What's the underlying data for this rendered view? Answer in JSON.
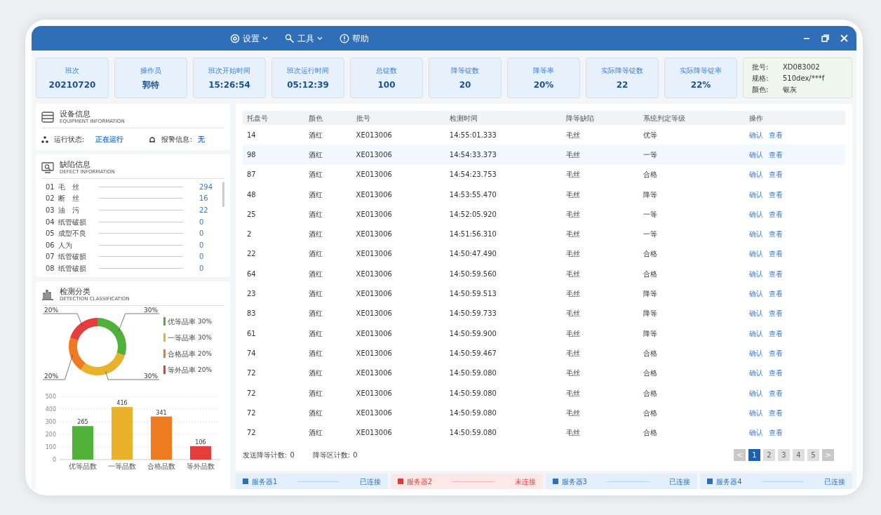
{
  "menu": [
    {
      "label": "设置",
      "dropdown": true
    },
    {
      "label": "工具",
      "dropdown": true
    },
    {
      "label": "帮助",
      "dropdown": false
    }
  ],
  "stats": [
    {
      "label": "班次",
      "value": "20210720"
    },
    {
      "label": "操作员",
      "value": "郭特"
    },
    {
      "label": "班次开始时间",
      "value": "15:26:54"
    },
    {
      "label": "班次运行时间",
      "value": "05:12:39"
    },
    {
      "label": "总锭数",
      "value": "100"
    },
    {
      "label": "降等锭数",
      "value": "20"
    },
    {
      "label": "降等率",
      "value": "20%"
    },
    {
      "label": "实际降等锭数",
      "value": "22"
    },
    {
      "label": "实际降等锭率",
      "value": "22%"
    }
  ],
  "batch_info": [
    {
      "label": "批号:",
      "value": "XD083002"
    },
    {
      "label": "规格:",
      "value": "510dex/***f"
    },
    {
      "label": "颜色:",
      "value": "银灰"
    }
  ],
  "equipment": {
    "title": "设备信息",
    "subtitle": "EQUIPMENT INFORMATION",
    "status_label": "运行状态:",
    "status_value": "正在运行",
    "alarm_label": "报警信息:",
    "alarm_value": "无"
  },
  "defects": {
    "title": "缺陷信息",
    "subtitle": "DEFECT INFORMATION",
    "items": [
      {
        "index": "01",
        "name": "毛　丝",
        "count": "294"
      },
      {
        "index": "02",
        "name": "断　丝",
        "count": "16"
      },
      {
        "index": "03",
        "name": "油　污",
        "count": "22"
      },
      {
        "index": "04",
        "name": "纸管破损",
        "count": "0"
      },
      {
        "index": "05",
        "name": "成型不良",
        "count": "0"
      },
      {
        "index": "06",
        "name": "人为",
        "count": "0"
      },
      {
        "index": "07",
        "name": "纸管破损",
        "count": "0"
      },
      {
        "index": "08",
        "name": "纸管破损",
        "count": "0"
      }
    ]
  },
  "classification": {
    "title": "检测分类",
    "subtitle": "DETECTION CLASSIFICATION",
    "legend": [
      {
        "value": "30%",
        "color": "#4fb03a"
      },
      {
        "value": "30%",
        "color": "#eab12a"
      },
      {
        "value": "20%",
        "color": "#ee7a22"
      },
      {
        "value": "20%",
        "color": "#e53c3c"
      }
    ],
    "donut": {
      "chart_data": {
        "type": "donut",
        "categories": [
          "优等品率",
          "一等品率",
          "合格品率",
          "等外品率"
        ],
        "series": [
          {
            "values": [
              30,
              30,
              20,
              20
            ]
          }
        ],
        "value_labels": [
          "30%",
          "30%",
          "20%",
          "20%"
        ]
      }
    },
    "bars": {
      "chart_data": {
        "type": "bar",
        "categories": [
          "优等品数",
          "一等品数",
          "合格品数",
          "等外品数"
        ],
        "series": [
          {
            "values": [
              265,
              416,
              341,
              106
            ]
          }
        ],
        "ylim": [
          0,
          500
        ],
        "yticks": [
          0,
          100,
          200,
          300,
          400,
          500
        ],
        "grid": true,
        "data_labels": true
      }
    }
  },
  "table": {
    "columns": [
      "托盘号",
      "颜色",
      "批号",
      "检测时间",
      "降等缺陷",
      "系统判定等级",
      "操作"
    ],
    "rows": [
      {
        "cells": [
          "14",
          "酒红",
          "XE013006",
          "14:55:01.333",
          "毛丝",
          "优等"
        ],
        "actions": [
          "确认",
          "查看"
        ],
        "selected": false
      },
      {
        "cells": [
          "98",
          "酒红",
          "XE013006",
          "14:54:33.373",
          "毛丝",
          "一等"
        ],
        "actions": [
          "确认",
          "查看"
        ],
        "selected": true
      },
      {
        "cells": [
          "87",
          "酒红",
          "XE013006",
          "14:54:23.753",
          "毛丝",
          "合格"
        ],
        "actions": [
          "确认",
          "查看"
        ],
        "selected": false
      },
      {
        "cells": [
          "48",
          "酒红",
          "XE013006",
          "14:53:55.470",
          "毛丝",
          "降等"
        ],
        "actions": [
          "确认",
          "查看"
        ],
        "selected": false
      },
      {
        "cells": [
          "25",
          "酒红",
          "XE013006",
          "14:52:05.920",
          "毛丝",
          "一等"
        ],
        "actions": [
          "确认",
          "查看"
        ],
        "selected": false
      },
      {
        "cells": [
          "2",
          "酒红",
          "XE013006",
          "14:51:56.310",
          "毛丝",
          "一等"
        ],
        "actions": [
          "确认",
          "查看"
        ],
        "selected": false
      },
      {
        "cells": [
          "22",
          "酒红",
          "XE013006",
          "14:50:47.490",
          "毛丝",
          "合格"
        ],
        "actions": [
          "确认",
          "查看"
        ],
        "selected": false
      },
      {
        "cells": [
          "64",
          "酒红",
          "XE013006",
          "14:50:59.560",
          "毛丝",
          "合格"
        ],
        "actions": [
          "确认",
          "查看"
        ],
        "selected": false
      },
      {
        "cells": [
          "23",
          "酒红",
          "XE013006",
          "14:50:59.513",
          "毛丝",
          "降等"
        ],
        "actions": [
          "确认",
          "查看"
        ],
        "selected": false
      },
      {
        "cells": [
          "83",
          "酒红",
          "XE013006",
          "14:50:59.733",
          "毛丝",
          "降等"
        ],
        "actions": [
          "确认",
          "查看"
        ],
        "selected": false
      },
      {
        "cells": [
          "61",
          "酒红",
          "XE013006",
          "14:50:59.900",
          "毛丝",
          "降等"
        ],
        "actions": [
          "确认",
          "查看"
        ],
        "selected": false
      },
      {
        "cells": [
          "74",
          "酒红",
          "XE013006",
          "14:50:59.467",
          "毛丝",
          "合格"
        ],
        "actions": [
          "确认",
          "查看"
        ],
        "selected": false
      },
      {
        "cells": [
          "72",
          "酒红",
          "XE013006",
          "14:50:59.080",
          "毛丝",
          "合格"
        ],
        "actions": [
          "确认",
          "查看"
        ],
        "selected": false
      },
      {
        "cells": [
          "72",
          "酒红",
          "XE013006",
          "14:50:59.080",
          "毛丝",
          "合格"
        ],
        "actions": [
          "确认",
          "查看"
        ],
        "selected": false
      },
      {
        "cells": [
          "72",
          "酒红",
          "XE013006",
          "14:50:59.080",
          "毛丝",
          "合格"
        ],
        "actions": [
          "确认",
          "查看"
        ],
        "selected": false
      },
      {
        "cells": [
          "72",
          "酒红",
          "XE013006",
          "14:50:59.080",
          "毛丝",
          "合格"
        ],
        "actions": [
          "确认",
          "查看"
        ],
        "selected": false
      }
    ]
  },
  "counters": [
    {
      "label": "发送降等计数:",
      "value": "0"
    },
    {
      "label": "降等区计数:",
      "value": "0"
    }
  ],
  "pagination": {
    "prev": "<",
    "next": ">",
    "pages": [
      {
        "label": "1",
        "selected": true
      },
      {
        "label": "2",
        "selected": false
      },
      {
        "label": "3",
        "selected": false
      },
      {
        "label": "4",
        "selected": false
      },
      {
        "label": "5",
        "selected": false
      }
    ]
  },
  "servers": [
    {
      "name": "服务器1",
      "status": "已连接",
      "connected": true
    },
    {
      "name": "服务器2",
      "status": "未连接",
      "connected": false
    },
    {
      "name": "服务器3",
      "status": "已连接",
      "connected": true
    },
    {
      "name": "服务器4",
      "status": "已连接",
      "connected": true
    }
  ]
}
